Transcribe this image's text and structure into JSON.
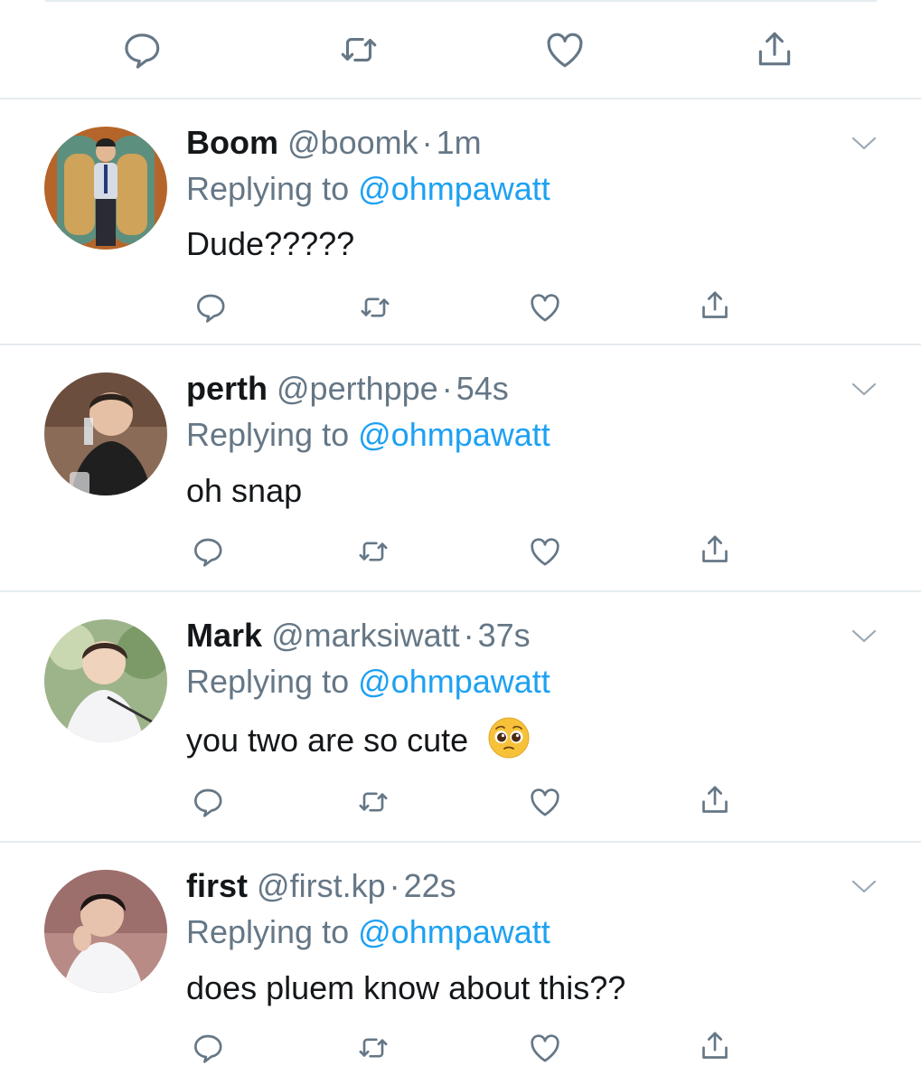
{
  "colors": {
    "text": "#14171a",
    "muted": "#657786",
    "link": "#1da1f2",
    "divider": "#e6ecf0",
    "icon": "#657786"
  },
  "actions_icons": [
    "reply-icon",
    "retweet-icon",
    "like-icon",
    "share-icon"
  ],
  "replying_prefix": "Replying to",
  "replies": [
    {
      "name": "Boom",
      "handle": "@boomk",
      "separator": "·",
      "time": "1m",
      "replying_to": "@ohmpawatt",
      "text": "Dude?????",
      "emoji": ""
    },
    {
      "name": "perth",
      "handle": "@perthppe",
      "separator": "·",
      "time": "54s",
      "replying_to": "@ohmpawatt",
      "text": "oh snap",
      "emoji": ""
    },
    {
      "name": "Mark",
      "handle": "@marksiwatt",
      "separator": "·",
      "time": "37s",
      "replying_to": "@ohmpawatt",
      "text": "you two are so cute",
      "emoji": "pleading-face-emoji"
    },
    {
      "name": "first",
      "handle": "@first.kp",
      "separator": "·",
      "time": "22s",
      "replying_to": "@ohmpawatt",
      "text": "does pluem know about this??",
      "emoji": ""
    }
  ]
}
